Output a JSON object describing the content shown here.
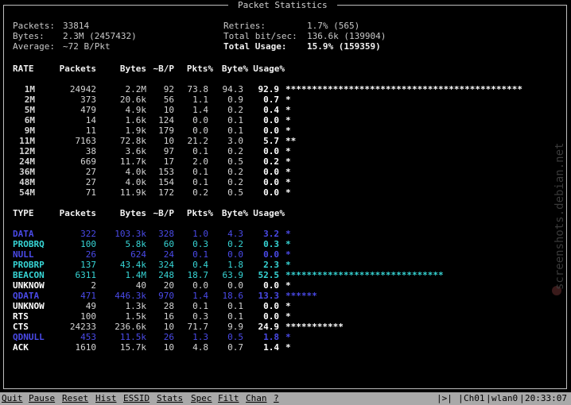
{
  "title": "Packet Statistics",
  "summary": {
    "packets_label": "Packets:",
    "packets_value": "33814",
    "bytes_label": "Bytes:",
    "bytes_value": "2.3M (2457432)",
    "average_label": "Average:",
    "average_value": "~72 B/Pkt",
    "retries_label": "Retries:",
    "retries_value": "1.7% (565)",
    "bitsec_label": "Total bit/sec:",
    "bitsec_value": "136.6k (139904)",
    "usage_label": "Total Usage:",
    "usage_value": "15.9% (159359)"
  },
  "rate_table": {
    "headers": [
      "RATE",
      "Packets",
      "Bytes",
      "~B/P",
      "Pkts%",
      "Byte%",
      "Usage%"
    ],
    "rows": [
      [
        "1M",
        "24942",
        "2.2M",
        "92",
        "73.8",
        "94.3",
        "92.9",
        "*********************************************"
      ],
      [
        "2M",
        "373",
        "20.6k",
        "56",
        "1.1",
        "0.9",
        "0.7",
        "*"
      ],
      [
        "5M",
        "479",
        "4.9k",
        "10",
        "1.4",
        "0.2",
        "0.4",
        "*"
      ],
      [
        "6M",
        "14",
        "1.6k",
        "124",
        "0.0",
        "0.1",
        "0.0",
        "*"
      ],
      [
        "9M",
        "11",
        "1.9k",
        "179",
        "0.0",
        "0.1",
        "0.0",
        "*"
      ],
      [
        "11M",
        "7163",
        "72.8k",
        "10",
        "21.2",
        "3.0",
        "5.7",
        "**"
      ],
      [
        "12M",
        "38",
        "3.6k",
        "97",
        "0.1",
        "0.2",
        "0.0",
        "*"
      ],
      [
        "24M",
        "669",
        "11.7k",
        "17",
        "2.0",
        "0.5",
        "0.2",
        "*"
      ],
      [
        "36M",
        "27",
        "4.0k",
        "153",
        "0.1",
        "0.2",
        "0.0",
        "*"
      ],
      [
        "48M",
        "27",
        "4.0k",
        "154",
        "0.1",
        "0.2",
        "0.0",
        "*"
      ],
      [
        "54M",
        "71",
        "11.9k",
        "172",
        "0.2",
        "0.5",
        "0.0",
        "*"
      ]
    ]
  },
  "type_table": {
    "headers": [
      "TYPE",
      "Packets",
      "Bytes",
      "~B/P",
      "Pkts%",
      "Byte%",
      "Usage%"
    ],
    "rows": [
      {
        "color": "blue",
        "cells": [
          "DATA",
          "322",
          "103.3k",
          "328",
          "1.0",
          "4.3",
          "3.2",
          "*"
        ]
      },
      {
        "color": "cyan",
        "cells": [
          "PROBRQ",
          "100",
          "5.8k",
          "60",
          "0.3",
          "0.2",
          "0.3",
          "*"
        ]
      },
      {
        "color": "blue",
        "cells": [
          "NULL",
          "26",
          "624",
          "24",
          "0.1",
          "0.0",
          "0.0",
          "*"
        ]
      },
      {
        "color": "cyan",
        "cells": [
          "PROBRP",
          "137",
          "43.4k",
          "324",
          "0.4",
          "1.8",
          "2.3",
          "*"
        ]
      },
      {
        "color": "cyan",
        "cells": [
          "BEACON",
          "6311",
          "1.4M",
          "248",
          "18.7",
          "63.9",
          "52.5",
          "******************************"
        ]
      },
      {
        "color": "white",
        "cells": [
          "UNKNOW",
          "2",
          "40",
          "20",
          "0.0",
          "0.0",
          "0.0",
          "*"
        ]
      },
      {
        "color": "blue",
        "cells": [
          "QDATA",
          "471",
          "446.3k",
          "970",
          "1.4",
          "18.6",
          "13.3",
          "******"
        ]
      },
      {
        "color": "white",
        "cells": [
          "UNKNOW",
          "49",
          "1.3k",
          "28",
          "0.1",
          "0.1",
          "0.0",
          "*"
        ]
      },
      {
        "color": "white",
        "cells": [
          "RTS",
          "100",
          "1.5k",
          "16",
          "0.3",
          "0.1",
          "0.0",
          "*"
        ]
      },
      {
        "color": "white",
        "cells": [
          "CTS",
          "24233",
          "236.6k",
          "10",
          "71.7",
          "9.9",
          "24.9",
          "***********"
        ]
      },
      {
        "color": "blue",
        "cells": [
          "QDNULL",
          "453",
          "11.5k",
          "26",
          "1.3",
          "0.5",
          "1.8",
          "*"
        ]
      },
      {
        "color": "white",
        "cells": [
          "ACK",
          "1610",
          "15.7k",
          "10",
          "4.8",
          "0.7",
          "1.4",
          "*"
        ]
      }
    ]
  },
  "menu": {
    "quit": "Quit",
    "pause": "Pause",
    "reset": "Reset",
    "hist": "Hist",
    "essid": "ESSID",
    "stats": "Stats",
    "spec": "Spec",
    "filt": "Filt",
    "chan": "Chan",
    "help": "?"
  },
  "status": {
    "indicator": "|>|",
    "channel": "Ch01",
    "iface": "wlan0",
    "clock": "20:33:07"
  },
  "watermark": "screenshots.debian.net",
  "colors": {
    "blue": "#4a4ae8",
    "cyan": "#37d6d6",
    "statusbar": "#a9a9a9"
  }
}
